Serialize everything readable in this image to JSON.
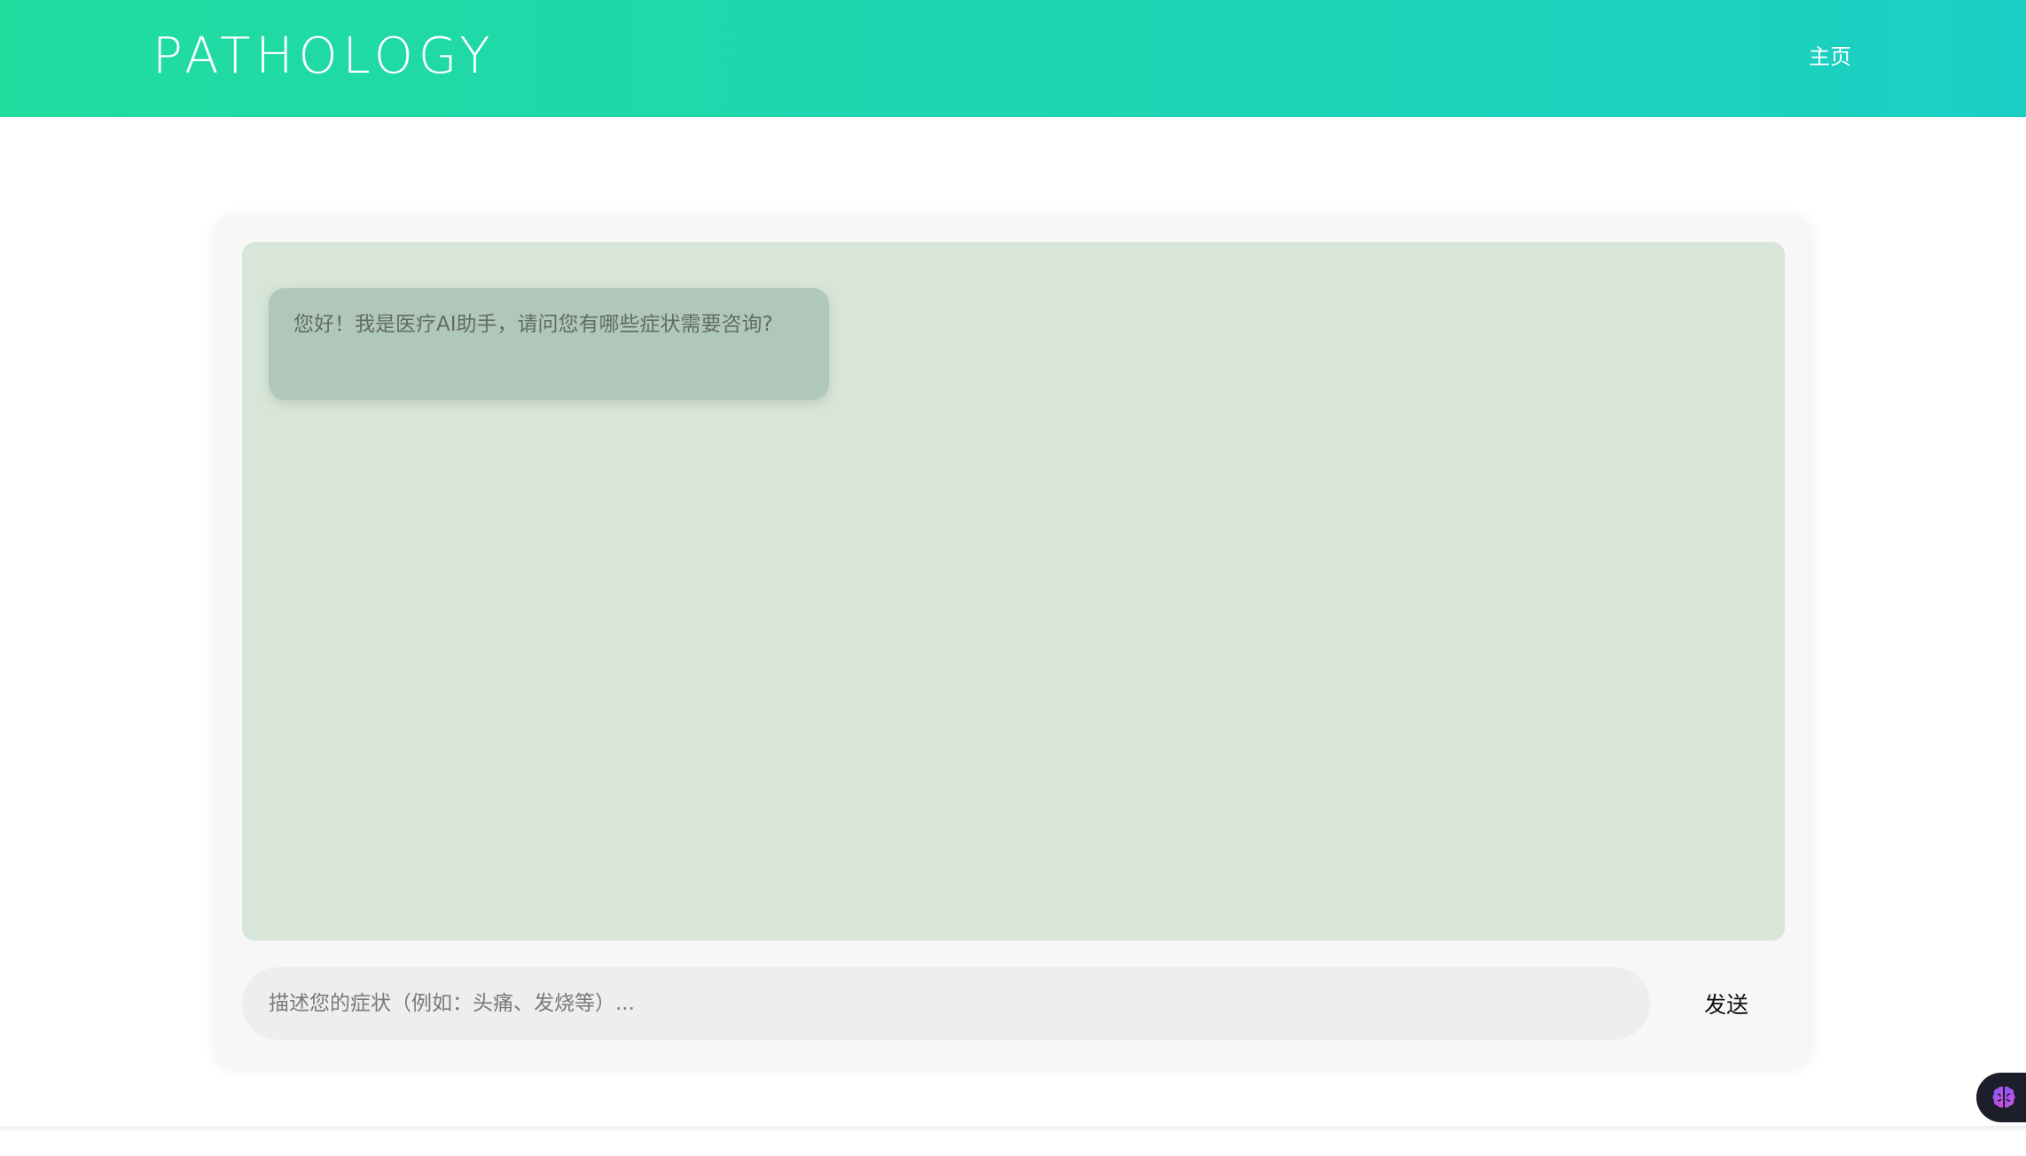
{
  "header": {
    "brand": "PATHOLOGY",
    "nav_home": "主页",
    "gradient_start": "#20dc9f",
    "gradient_end": "#1ccfc4"
  },
  "chat": {
    "messages": [
      {
        "role": "assistant",
        "text": "您好！我是医疗AI助手，请问您有哪些症状需要咨询?"
      }
    ],
    "input_placeholder": "描述您的症状（例如：头痛、发烧等）...",
    "input_value": "",
    "send_label": "发送",
    "panel_color": "#d8e6d9",
    "bubble_color": "#b0c8bb"
  },
  "floating": {
    "icon": "brain-icon"
  }
}
